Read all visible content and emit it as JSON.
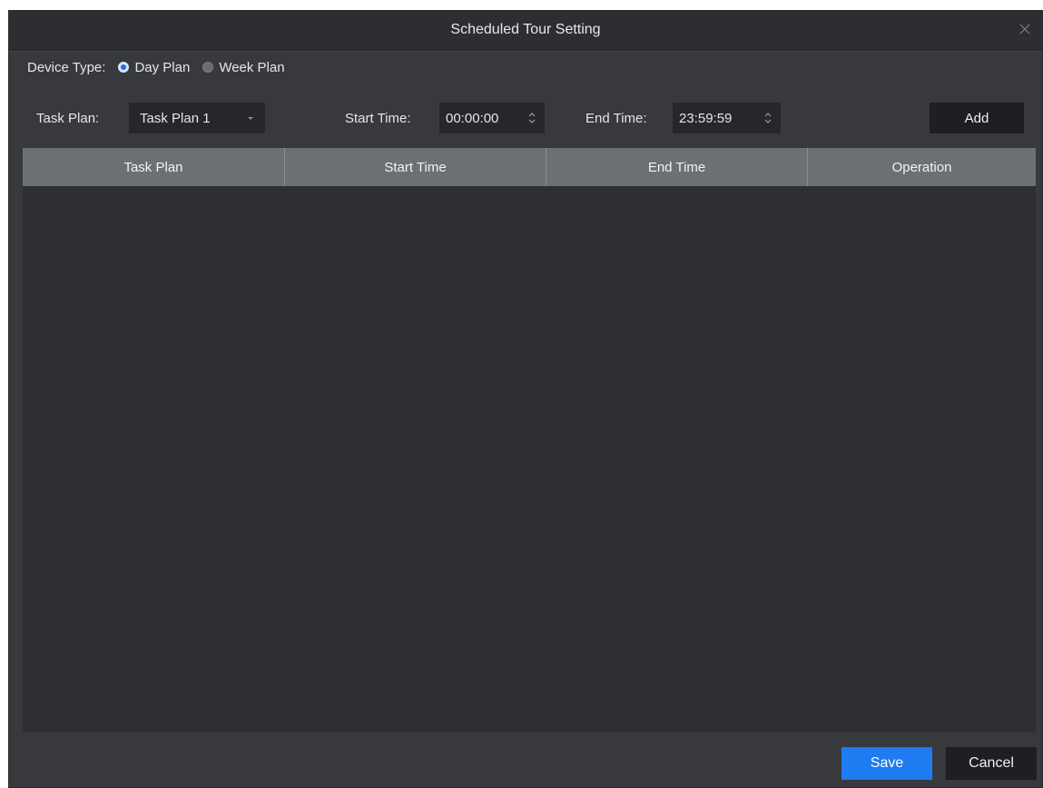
{
  "dialog": {
    "title": "Scheduled Tour Setting",
    "close_icon": "close-icon"
  },
  "device_type": {
    "label": "Device Type:",
    "options": [
      {
        "label": "Day Plan",
        "selected": true
      },
      {
        "label": "Week Plan",
        "selected": false
      }
    ]
  },
  "task_plan": {
    "label": "Task Plan:",
    "value": "Task Plan 1"
  },
  "start_time": {
    "label": "Start Time:",
    "value": "00:00:00"
  },
  "end_time": {
    "label": "End Time:",
    "value": "23:59:59"
  },
  "add_label": "Add",
  "table": {
    "columns": [
      "Task Plan",
      "Start Time",
      "End Time",
      "Operation"
    ],
    "rows": []
  },
  "footer": {
    "save_label": "Save",
    "cancel_label": "Cancel"
  },
  "colors": {
    "accent": "#1e7bf0",
    "background": "#37393d",
    "header": "#6c7074"
  }
}
